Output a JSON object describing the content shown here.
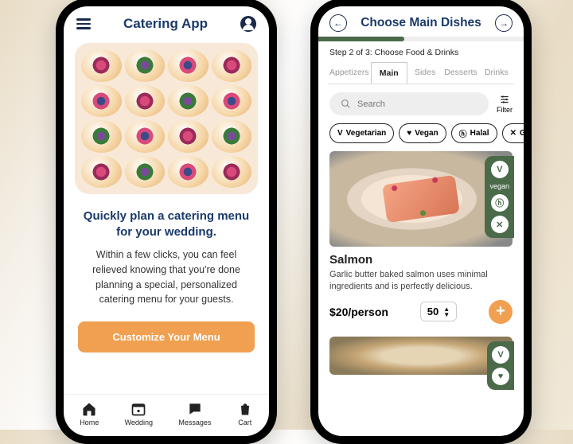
{
  "left": {
    "app_title": "Catering App",
    "hero_heading": "Quickly plan a catering menu for your wedding.",
    "hero_body": "Within a few clicks, you can feel relieved knowing that you're done planning a special, personalized catering menu for your guests.",
    "cta_label": "Customize Your Menu",
    "tabs": [
      {
        "label": "Home",
        "icon": "home-icon"
      },
      {
        "label": "Wedding",
        "icon": "calendar-icon"
      },
      {
        "label": "Messages",
        "icon": "chat-icon"
      },
      {
        "label": "Cart",
        "icon": "bag-icon"
      }
    ]
  },
  "right": {
    "title": "Choose Main Dishes",
    "step_label": "Step 2 of 3: Choose Food & Drinks",
    "categories": [
      "Appetizers",
      "Main",
      "Sides",
      "Desserts",
      "Drinks"
    ],
    "active_category": "Main",
    "search_placeholder": "Search",
    "filter_label": "Filter",
    "diet_chips": [
      "Vegetarian",
      "Vegan",
      "Halal",
      "Glu"
    ],
    "dish": {
      "name": "Salmon",
      "description": "Garlic butter baked salmon uses minimal ingredients and is perfectly delicious.",
      "price": "$20/person",
      "quantity": "50",
      "badge_label": "vegan"
    }
  },
  "colors": {
    "brand_navy": "#1a3a6a",
    "accent_orange": "#f0a050",
    "accent_green": "#4a6a4a"
  }
}
